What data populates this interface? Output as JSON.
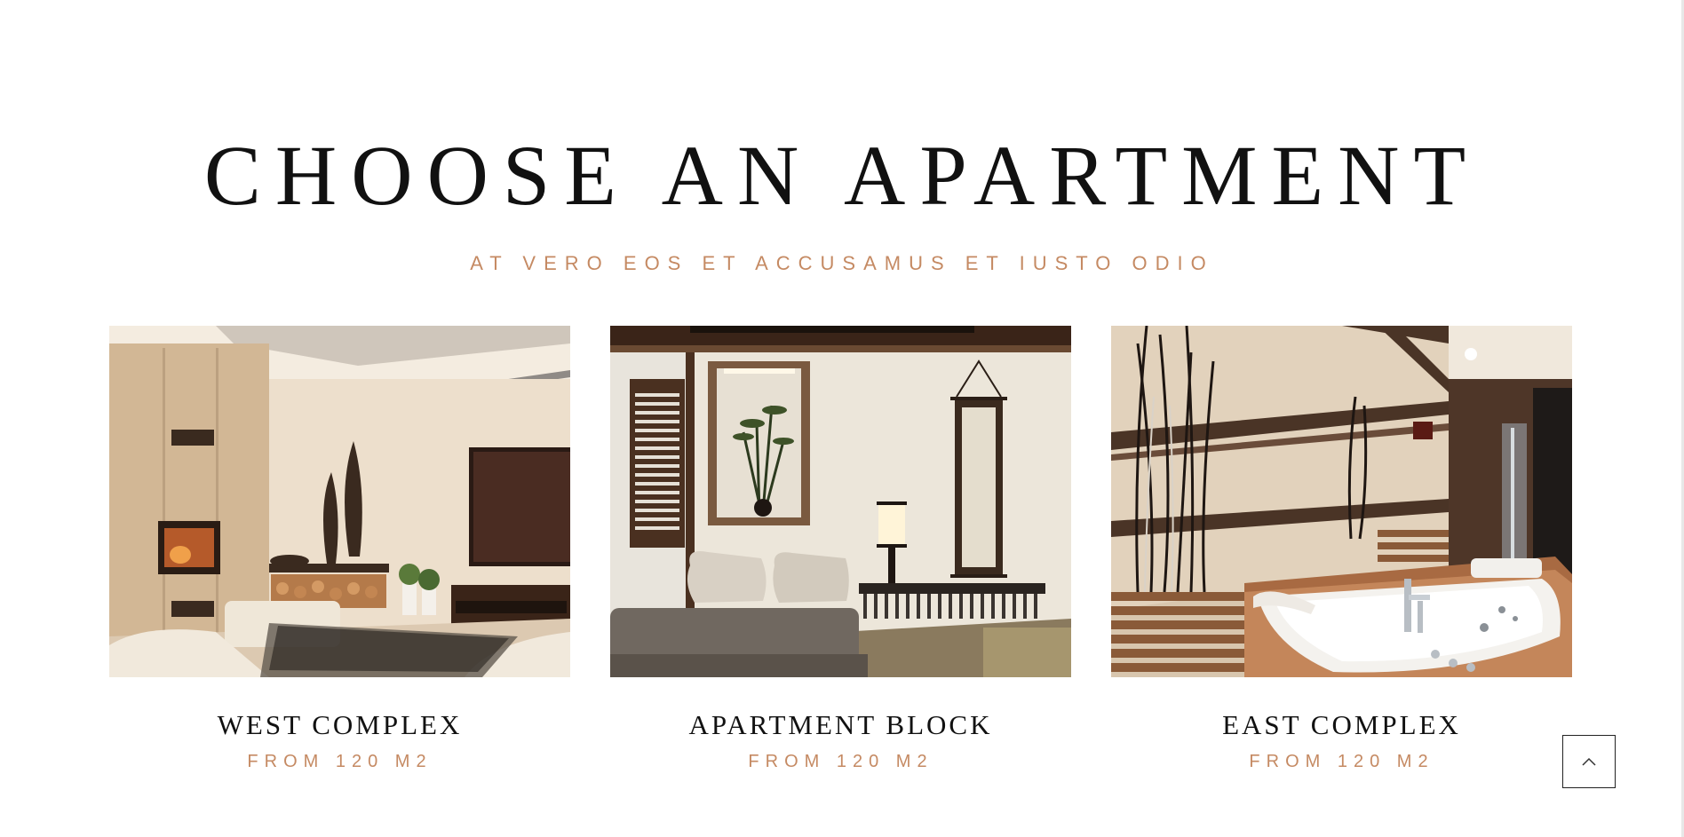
{
  "heading": {
    "title": "CHOOSE AN APARTMENT",
    "subtitle": "AT VERO EOS ET ACCUSAMUS ET IUSTO ODIO"
  },
  "cards": [
    {
      "name": "WEST COMPLEX",
      "sub": "FROM 120 M2",
      "image": "living-room-fireplace-photo"
    },
    {
      "name": "APARTMENT BLOCK",
      "sub": "FROM 120 M2",
      "image": "japanese-bedroom-photo"
    },
    {
      "name": "EAST COMPLEX",
      "sub": "FROM 120 M2",
      "image": "bathroom-jacuzzi-photo"
    }
  ],
  "back_to_top": {
    "icon": "chevron-up-icon"
  },
  "colors": {
    "accent": "#c58a63",
    "text": "#111111",
    "background": "#ffffff"
  }
}
